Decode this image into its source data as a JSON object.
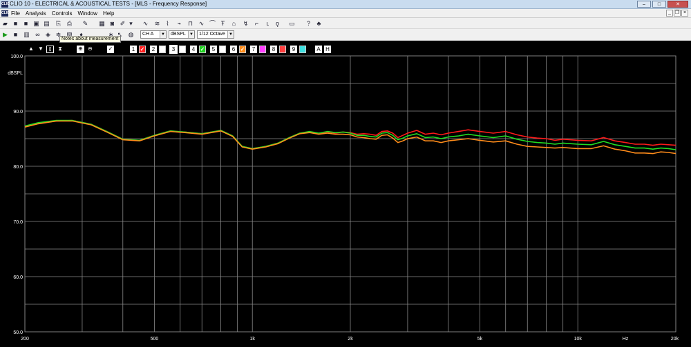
{
  "window": {
    "title": "CLIO 10 - ELECTRICAL & ACOUSTICAL TESTS - [MLS - Frequency Response]",
    "app_icon_text": "CLIO"
  },
  "menu": {
    "items": [
      "File",
      "Analysis",
      "Controls",
      "Window",
      "Help"
    ]
  },
  "toolbar": {
    "channel": "CH A",
    "units": "dBSPL",
    "smoothing": "1/12 Octave",
    "tooltip": "Notes about measurement"
  },
  "overlay_controls": {
    "memory_numbers": [
      "1",
      "2",
      "3",
      "4",
      "5",
      "6",
      "7",
      "8",
      "9"
    ],
    "memory_checked": [
      true,
      false,
      false,
      true,
      false,
      true,
      false,
      false,
      false
    ],
    "memory_colors": [
      "#ff2020",
      "#ffffff",
      "#ffffff",
      "#20d020",
      "#ffffff",
      "#ff8c1a",
      "#ff40ff",
      "#ff4040",
      "#40e0e0"
    ],
    "extra_buttons": [
      "A",
      "H"
    ]
  },
  "chart_data": {
    "type": "line",
    "ylabel": "dBSPL",
    "xlabel": "Hz",
    "ylim": [
      50,
      100
    ],
    "xlim": [
      200,
      20000
    ],
    "x_scale": "log",
    "y_ticks": [
      "100.0",
      "90.0",
      "80.0",
      "70.0",
      "60.0",
      "50.0"
    ],
    "x_ticks": [
      {
        "value": 200,
        "label": "200"
      },
      {
        "value": 500,
        "label": "500"
      },
      {
        "value": 1000,
        "label": "1k"
      },
      {
        "value": 2000,
        "label": "2k"
      },
      {
        "value": 5000,
        "label": "5k"
      },
      {
        "value": 10000,
        "label": "10k"
      },
      {
        "value": 20000,
        "label": "20k"
      }
    ],
    "grid": true,
    "background": "#000000",
    "series": [
      {
        "color": "#ff1a1a",
        "x": [
          200,
          220,
          250,
          280,
          320,
          360,
          400,
          450,
          500,
          560,
          620,
          700,
          800,
          870,
          930,
          1000,
          1100,
          1200,
          1300,
          1400,
          1500,
          1600,
          1700,
          1800,
          1900,
          2000,
          2100,
          2200,
          2300,
          2400,
          2500,
          2600,
          2700,
          2800,
          2900,
          3000,
          3200,
          3400,
          3600,
          3800,
          4000,
          4300,
          4600,
          5000,
          5500,
          6000,
          6500,
          7000,
          7500,
          8000,
          8500,
          9000,
          10000,
          11000,
          12000,
          13000,
          14000,
          15000,
          16000,
          17000,
          18000,
          19000,
          20000
        ],
        "y": [
          87.2,
          87.8,
          88.2,
          88.3,
          87.6,
          86.2,
          84.9,
          84.7,
          85.6,
          86.4,
          86.2,
          85.9,
          86.5,
          85.5,
          83.6,
          83.2,
          83.6,
          84.2,
          85.2,
          86.0,
          86.2,
          85.9,
          86.2,
          86.0,
          86.2,
          86.1,
          85.8,
          85.9,
          85.8,
          85.6,
          86.3,
          86.4,
          86.0,
          85.2,
          85.6,
          86.0,
          86.5,
          85.8,
          86.0,
          85.7,
          86.0,
          86.3,
          86.6,
          86.3,
          86.0,
          86.3,
          85.7,
          85.3,
          85.1,
          85.0,
          84.7,
          84.9,
          84.7,
          84.6,
          85.2,
          84.6,
          84.3,
          84.0,
          84.0,
          83.8,
          84.0,
          83.9,
          83.8
        ]
      },
      {
        "color": "#22dd22",
        "x": [
          200,
          220,
          250,
          280,
          320,
          360,
          400,
          450,
          500,
          560,
          620,
          700,
          800,
          870,
          930,
          1000,
          1100,
          1200,
          1300,
          1400,
          1500,
          1600,
          1700,
          1800,
          1900,
          2000,
          2100,
          2200,
          2300,
          2400,
          2500,
          2600,
          2700,
          2800,
          2900,
          3000,
          3200,
          3400,
          3600,
          3800,
          4000,
          4300,
          4600,
          5000,
          5500,
          6000,
          6500,
          7000,
          7500,
          8000,
          8500,
          9000,
          10000,
          11000,
          12000,
          13000,
          14000,
          15000,
          16000,
          17000,
          18000,
          19000,
          20000
        ],
        "y": [
          87.3,
          87.9,
          88.3,
          88.3,
          87.6,
          86.2,
          84.9,
          84.7,
          85.6,
          86.4,
          86.2,
          85.9,
          86.5,
          85.5,
          83.6,
          83.2,
          83.6,
          84.2,
          85.2,
          86.0,
          86.3,
          86.0,
          86.3,
          86.1,
          86.2,
          86.0,
          85.6,
          85.6,
          85.4,
          85.3,
          86.0,
          86.1,
          85.6,
          84.8,
          85.1,
          85.5,
          85.9,
          85.2,
          85.3,
          85.0,
          85.3,
          85.5,
          85.8,
          85.5,
          85.2,
          85.5,
          84.9,
          84.5,
          84.3,
          84.2,
          84.0,
          84.2,
          84.0,
          83.9,
          84.5,
          83.9,
          83.6,
          83.3,
          83.3,
          83.1,
          83.3,
          83.2,
          83.0
        ]
      },
      {
        "color": "#ff8c1a",
        "x": [
          200,
          220,
          250,
          280,
          320,
          360,
          400,
          450,
          500,
          560,
          620,
          700,
          800,
          870,
          930,
          1000,
          1100,
          1200,
          1300,
          1400,
          1500,
          1600,
          1700,
          1800,
          1900,
          2000,
          2100,
          2200,
          2300,
          2400,
          2500,
          2600,
          2700,
          2800,
          2900,
          3000,
          3200,
          3400,
          3600,
          3800,
          4000,
          4300,
          4600,
          5000,
          5500,
          6000,
          6500,
          7000,
          7500,
          8000,
          8500,
          9000,
          10000,
          11000,
          12000,
          13000,
          14000,
          15000,
          16000,
          17000,
          18000,
          19000,
          20000
        ],
        "y": [
          87.1,
          87.7,
          88.2,
          88.2,
          87.5,
          86.1,
          84.8,
          84.6,
          85.5,
          86.3,
          86.1,
          85.8,
          86.4,
          85.4,
          83.5,
          83.1,
          83.5,
          84.1,
          85.1,
          85.9,
          86.1,
          85.8,
          86.0,
          85.8,
          85.8,
          85.7,
          85.3,
          85.2,
          85.0,
          84.9,
          85.6,
          85.7,
          85.1,
          84.3,
          84.6,
          85.0,
          85.3,
          84.6,
          84.6,
          84.3,
          84.6,
          84.8,
          85.0,
          84.7,
          84.4,
          84.6,
          84.0,
          83.6,
          83.5,
          83.4,
          83.3,
          83.4,
          83.2,
          83.2,
          83.7,
          83.1,
          82.8,
          82.4,
          82.4,
          82.3,
          82.6,
          82.5,
          82.3
        ]
      }
    ]
  }
}
